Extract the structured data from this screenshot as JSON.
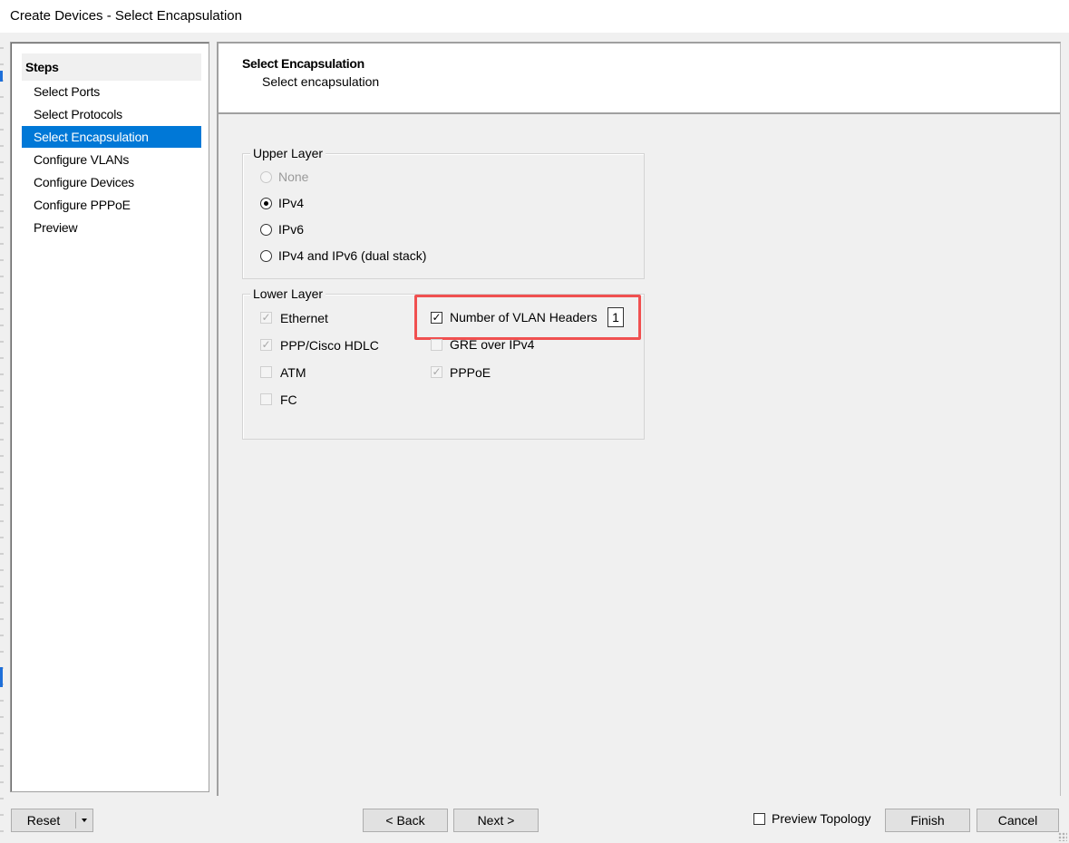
{
  "window": {
    "title": "Create Devices - Select Encapsulation"
  },
  "steps": {
    "header": "Steps",
    "items": [
      {
        "label": "Select Ports",
        "active": false
      },
      {
        "label": "Select Protocols",
        "active": false
      },
      {
        "label": "Select Encapsulation",
        "active": true
      },
      {
        "label": "Configure VLANs",
        "active": false
      },
      {
        "label": "Configure Devices",
        "active": false
      },
      {
        "label": "Configure PPPoE",
        "active": false
      },
      {
        "label": "Preview",
        "active": false
      }
    ]
  },
  "content": {
    "title": "Select Encapsulation",
    "subtitle": "Select encapsulation",
    "upper_layer": {
      "legend": "Upper Layer",
      "options": [
        {
          "label": "None",
          "checked": false,
          "disabled": true
        },
        {
          "label": "IPv4",
          "checked": true,
          "disabled": false
        },
        {
          "label": "IPv6",
          "checked": false,
          "disabled": false
        },
        {
          "label": "IPv4 and IPv6 (dual stack)",
          "checked": false,
          "disabled": false
        }
      ]
    },
    "lower_layer": {
      "legend": "Lower Layer",
      "options": [
        {
          "label": "Ethernet",
          "checked": true,
          "disabled": true
        },
        {
          "label": "PPP/Cisco HDLC",
          "checked": true,
          "disabled": true
        },
        {
          "label": "ATM",
          "checked": false,
          "disabled": true
        },
        {
          "label": "FC",
          "checked": false,
          "disabled": true
        },
        {
          "label": "Number of VLAN Headers",
          "checked": true,
          "disabled": false
        },
        {
          "label": "GRE over IPv4",
          "checked": false,
          "disabled": true
        },
        {
          "label": "PPPoE",
          "checked": true,
          "disabled": true
        }
      ],
      "vlan_headers_value": "1"
    }
  },
  "footer": {
    "reset_label": "Reset",
    "back_label": "< Back",
    "next_label": "Next >",
    "preview_topology_label": "Preview Topology",
    "preview_topology_checked": false,
    "finish_label": "Finish",
    "cancel_label": "Cancel"
  },
  "colors": {
    "accent": "#0078d7",
    "highlight": "#f05050"
  }
}
